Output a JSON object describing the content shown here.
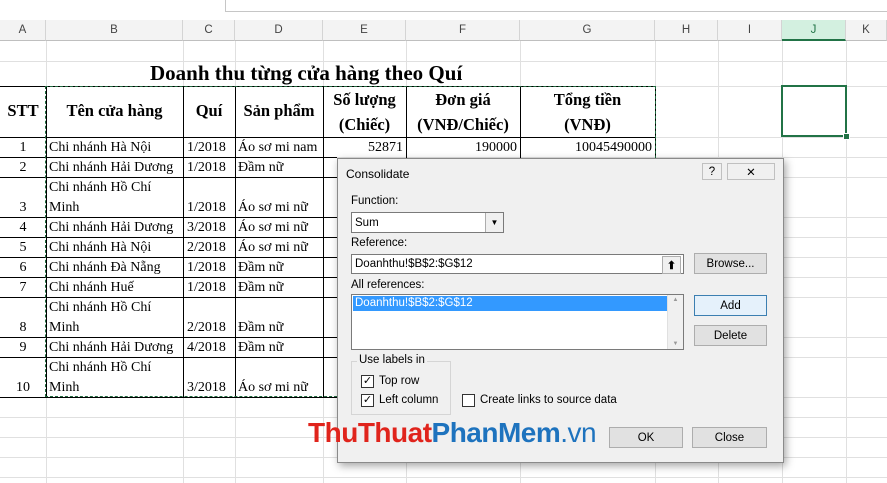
{
  "columns": [
    "A",
    "B",
    "C",
    "D",
    "E",
    "F",
    "G",
    "H",
    "I",
    "J",
    "K"
  ],
  "selected_column": "J",
  "title": "Doanh thu từng cửa hàng theo Quí",
  "headers": {
    "stt": "STT",
    "store": "Tên cửa hàng",
    "quarter": "Quí",
    "product": "Sản phẩm",
    "qty_line1": "Số lượng",
    "qty_line2": "(Chiếc)",
    "price_line1": "Đơn giá",
    "price_line2": "(VNĐ/Chiếc)",
    "total_line1": "Tổng tiền",
    "total_line2": "(VNĐ)"
  },
  "rows": [
    {
      "stt": "1",
      "store_line1": "Chi nhánh Hà Nội",
      "store_line2": "",
      "quarter": "1/2018",
      "product": "Áo sơ mi nam",
      "qty": "52871",
      "price": "190000",
      "total": "10045490000"
    },
    {
      "stt": "2",
      "store_line1": "Chi nhánh Hải Dương",
      "store_line2": "",
      "quarter": "1/2018",
      "product": "Đầm nữ",
      "qty": "",
      "price": "",
      "total": ""
    },
    {
      "stt": "3",
      "store_line1": "Chi nhánh Hồ Chí",
      "store_line2": "Minh",
      "quarter": "1/2018",
      "product": "Áo sơ mi nữ",
      "qty": "",
      "price": "",
      "total": ""
    },
    {
      "stt": "4",
      "store_line1": "Chi nhánh Hải Dương",
      "store_line2": "",
      "quarter": "3/2018",
      "product": "Áo sơ mi nữ",
      "qty": "",
      "price": "",
      "total": ""
    },
    {
      "stt": "5",
      "store_line1": "Chi nhánh Hà Nội",
      "store_line2": "",
      "quarter": "2/2018",
      "product": "Áo sơ mi nữ",
      "qty": "",
      "price": "",
      "total": ""
    },
    {
      "stt": "6",
      "store_line1": "Chi nhánh Đà Nẵng",
      "store_line2": "",
      "quarter": "1/2018",
      "product": "Đầm nữ",
      "qty": "",
      "price": "",
      "total": ""
    },
    {
      "stt": "7",
      "store_line1": "Chi nhánh Huế",
      "store_line2": "",
      "quarter": "1/2018",
      "product": "Đầm nữ",
      "qty": "",
      "price": "",
      "total": ""
    },
    {
      "stt": "8",
      "store_line1": "Chi nhánh Hồ Chí",
      "store_line2": "Minh",
      "quarter": "2/2018",
      "product": "Đầm nữ",
      "qty": "",
      "price": "",
      "total": ""
    },
    {
      "stt": "9",
      "store_line1": "Chi nhánh Hải Dương",
      "store_line2": "",
      "quarter": "4/2018",
      "product": "Đầm nữ",
      "qty": "",
      "price": "",
      "total": ""
    },
    {
      "stt": "10",
      "store_line1": "Chi nhánh Hồ Chí",
      "store_line2": "Minh",
      "quarter": "3/2018",
      "product": "Áo sơ mi nữ",
      "qty": "",
      "price": "",
      "total": ""
    }
  ],
  "dialog": {
    "title": "Consolidate",
    "help_label": "?",
    "close_label": "✕",
    "function_label": "Function:",
    "function_value": "Sum",
    "reference_label": "Reference:",
    "reference_value": "Doanhthu!$B$2:$G$12",
    "browse_label": "Browse...",
    "all_refs_label": "All references:",
    "all_refs_items": [
      "Doanhthu!$B$2:$G$12"
    ],
    "add_label": "Add",
    "delete_label": "Delete",
    "use_labels_label": "Use labels in",
    "top_row_label": "Top row",
    "top_row_checked": true,
    "left_column_label": "Left column",
    "left_column_checked": true,
    "create_links_label": "Create links to source data",
    "create_links_checked": false,
    "ok_label": "OK",
    "close_btn_label": "Close"
  },
  "watermark": {
    "part1": "Thu",
    "part2": "Thuat",
    "part3": "PhanMem",
    "part4": ".vn",
    "color_red": "#e0241c",
    "color_blue": "#1e73be"
  },
  "colors": {
    "excel_green": "#217346",
    "dialog_bg": "#f0f0f0",
    "selection_blue": "#3399ff"
  }
}
